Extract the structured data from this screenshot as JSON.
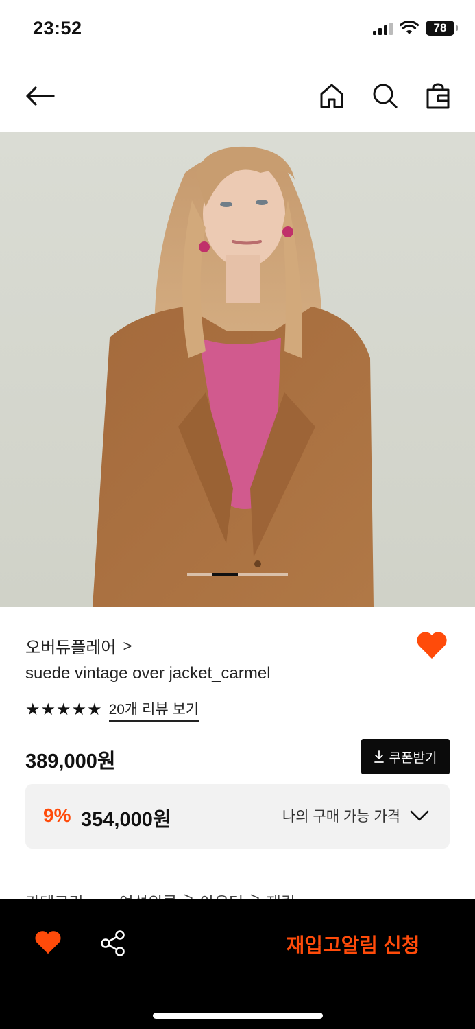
{
  "status_bar": {
    "time": "23:52",
    "battery": "78"
  },
  "header": {
    "back_icon": "arrow-left-icon",
    "home_icon": "home-icon",
    "search_icon": "search-icon",
    "cart_icon": "shopping-bag-icon"
  },
  "gallery": {
    "image_description_icon": "product-photo",
    "active_index": 2,
    "total": 4
  },
  "product": {
    "brand": "오버듀플레어",
    "brand_chevron": ">",
    "name": "suede vintage over jacket_carmel",
    "rating_stars": 5,
    "review_link": "20개 리뷰 보기",
    "price": "389,000원",
    "coupon_label": "쿠폰받기",
    "discount_percent": "9%",
    "discount_price": "354,000원",
    "my_price_label": "나의 구매 가능 가격"
  },
  "category": {
    "label": "카테고리",
    "path": [
      "여성의류",
      ">",
      "아우터",
      ">",
      "재킷"
    ]
  },
  "bottom_bar": {
    "restock_label": "재입고알림 신청"
  },
  "colors": {
    "accent": "#ff4b0a",
    "primary_text": "#111111",
    "bottom_bar_bg": "#000000",
    "discount_box_bg": "#f2f2f2"
  }
}
